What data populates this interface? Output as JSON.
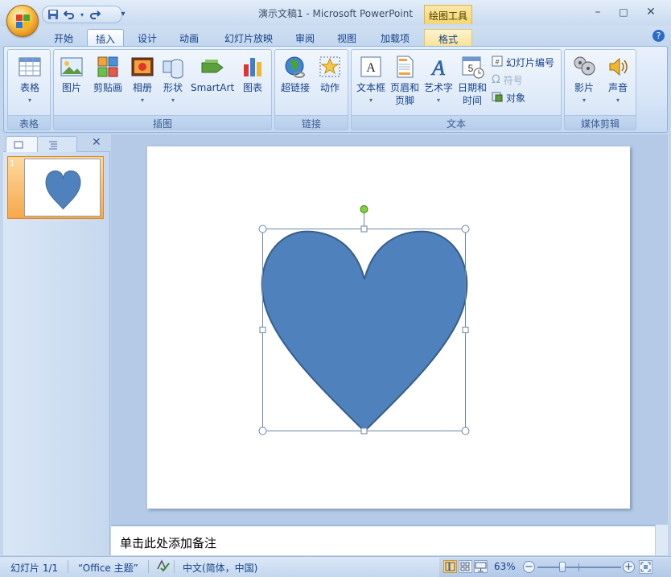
{
  "window": {
    "title": "演示文稿1 - Microsoft PowerPoint",
    "contextual_tab_group": "绘图工具",
    "controls": {
      "minimize": "–",
      "maximize": "□",
      "close": "✕"
    }
  },
  "qat": {
    "save_icon": "save-icon",
    "undo_icon": "undo-icon",
    "redo_icon": "redo-icon",
    "customize": "▾"
  },
  "tabs": [
    {
      "label": "开始"
    },
    {
      "label": "插入",
      "active": true
    },
    {
      "label": "设计"
    },
    {
      "label": "动画"
    },
    {
      "label": "幻灯片放映"
    },
    {
      "label": "审阅"
    },
    {
      "label": "视图"
    },
    {
      "label": "加载项"
    },
    {
      "label": "格式",
      "contextual": true
    }
  ],
  "ribbon": {
    "groups": {
      "table": {
        "label": "表格",
        "items": [
          "表格"
        ]
      },
      "illustrations": {
        "label": "插图",
        "items": [
          "图片",
          "剪贴画",
          "相册",
          "形状",
          "SmartArt",
          "图表"
        ]
      },
      "links": {
        "label": "链接",
        "items": [
          "超链接",
          "动作"
        ]
      },
      "text": {
        "label": "文本",
        "items": [
          "文本框",
          "页眉和",
          "页脚",
          "艺术字",
          "日期和",
          "时间"
        ],
        "small_items": [
          "幻灯片编号",
          "符号",
          "对象"
        ]
      },
      "media": {
        "label": "媒体剪辑",
        "items": [
          "影片",
          "声音"
        ]
      }
    }
  },
  "slides_panel": {
    "close": "✕",
    "slide_number": "1"
  },
  "notes": {
    "placeholder": "单击此处添加备注"
  },
  "status": {
    "slide": "幻灯片 1/1",
    "theme": "“Office 主题”",
    "language": "中文(简体，中国)",
    "zoom": "63%",
    "zoom_level": 0.63
  },
  "colors": {
    "heart_fill": "#4f81bd",
    "heart_stroke": "#385d8a",
    "rotation_handle": "#7dd33a"
  }
}
